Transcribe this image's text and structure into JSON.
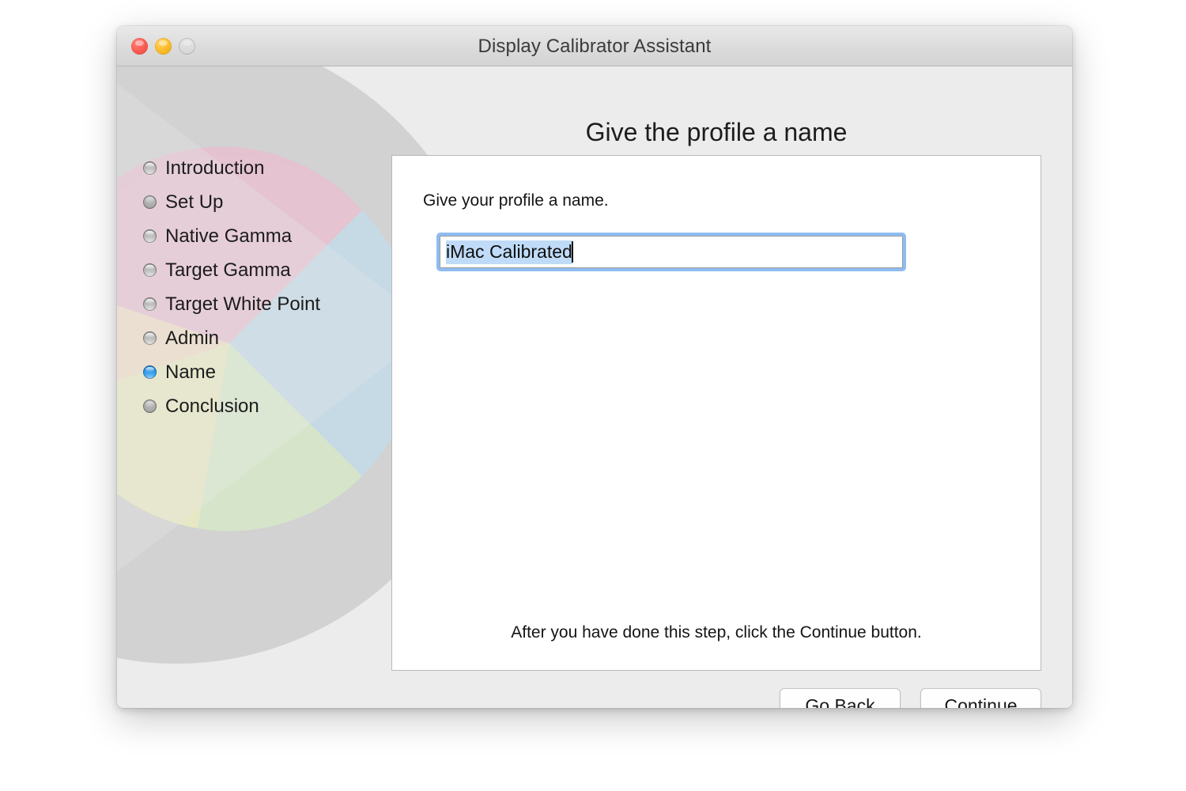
{
  "window": {
    "title": "Display Calibrator Assistant",
    "traffic_lights": [
      {
        "name": "close",
        "color": "#fc5f56",
        "enabled": true
      },
      {
        "name": "minimize",
        "color": "#fdbe2e",
        "enabled": true
      },
      {
        "name": "zoom",
        "color": "#d6d6d6",
        "enabled": false
      }
    ]
  },
  "heading": "Give the profile a name",
  "sidebar": {
    "steps": [
      {
        "label": "Introduction",
        "state": "done"
      },
      {
        "label": "Set Up",
        "state": "pending"
      },
      {
        "label": "Native Gamma",
        "state": "done"
      },
      {
        "label": "Target Gamma",
        "state": "done"
      },
      {
        "label": "Target White Point",
        "state": "done"
      },
      {
        "label": "Admin",
        "state": "done"
      },
      {
        "label": "Name",
        "state": "current"
      },
      {
        "label": "Conclusion",
        "state": "pending"
      }
    ]
  },
  "panel": {
    "instruction": "Give your profile a name.",
    "name_field": {
      "value": "iMac Calibrated",
      "placeholder": "Profile name",
      "selected": true,
      "focused": true,
      "selection_color": "#bfdbf7",
      "focus_ring_color": "#8fbcf2"
    },
    "footnote": "After you have done this step, click the Continue button."
  },
  "actions": {
    "go_back": "Go Back",
    "continue": "Continue"
  },
  "colors": {
    "window_background": "#ececec",
    "panel_background": "#ffffff",
    "titlebar_top": "#e9e9e9",
    "titlebar_bottom": "#d3d3d3",
    "accent_blue": "#0a7ad6",
    "text_primary": "#1c1c1c"
  },
  "backdrop_art": {
    "name": "color-wheel-graphic",
    "wedge_gray": "#d2d2d2",
    "circle_gray": "#d0d0d0",
    "segments": [
      {
        "name": "pink",
        "color": "#e8c4d2"
      },
      {
        "name": "cyan",
        "color": "#c3dbe6"
      },
      {
        "name": "green",
        "color": "#d7e6c8"
      },
      {
        "name": "yellow",
        "color": "#e9e9c0"
      },
      {
        "name": "peach",
        "color": "#eedcc6"
      }
    ]
  }
}
